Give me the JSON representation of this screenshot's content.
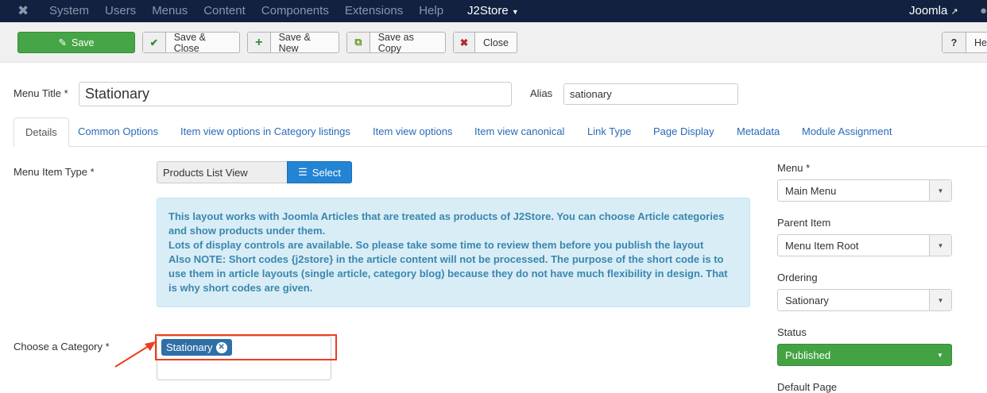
{
  "topnav": {
    "items": [
      "System",
      "Users",
      "Menus",
      "Content",
      "Components",
      "Extensions",
      "Help"
    ],
    "j2store": "J2Store",
    "site": "Joomla"
  },
  "toolbar": {
    "save": "Save",
    "save_close": "Save & Close",
    "save_new": "Save & New",
    "save_copy": "Save as Copy",
    "close": "Close",
    "help": "Help"
  },
  "form": {
    "menu_title_label": "Menu Title *",
    "menu_title": "Stationary",
    "alias_label": "Alias",
    "alias": "sationary"
  },
  "tabs": [
    "Details",
    "Common Options",
    "Item view options in Category listings",
    "Item view options",
    "Item view canonical",
    "Link Type",
    "Page Display",
    "Metadata",
    "Module Assignment"
  ],
  "details": {
    "type_label": "Menu Item Type *",
    "type_value": "Products List View",
    "select": "Select",
    "info": [
      "This layout works with Joomla Articles that are treated as products of J2Store. You can choose Article categories and show products under them.",
      "Lots of display controls are available. So please take some time to review them before you publish the layout",
      "Also NOTE: Short codes {j2store} in the article content will not be processed. The purpose of the short code is to use them in article layouts (single article, category blog) because they do not have much flexibility in design. That is why short codes are given."
    ],
    "category_label": "Choose a Category *",
    "category_tag": "Stationary"
  },
  "side": {
    "menu_label": "Menu *",
    "menu": "Main Menu",
    "parent_label": "Parent Item",
    "parent": "Menu Item Root",
    "ordering_label": "Ordering",
    "ordering": "Sationary",
    "status_label": "Status",
    "status": "Published",
    "default_label": "Default Page"
  },
  "colors": {
    "accent": "#2a69b8",
    "green": "#46a546",
    "navbar": "#11213f",
    "highlight": "#f03c1f"
  }
}
